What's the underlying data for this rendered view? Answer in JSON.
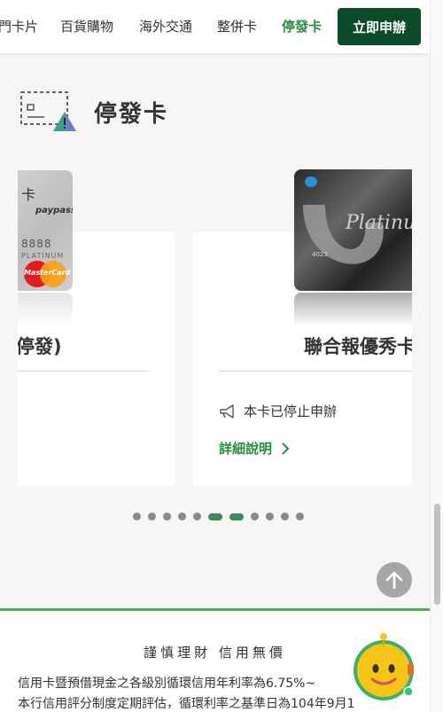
{
  "nav": {
    "items": [
      {
        "label": "門卡片"
      },
      {
        "label": "百貨購物"
      },
      {
        "label": "海外交通"
      },
      {
        "label": "整併卡"
      },
      {
        "label": "停發卡"
      }
    ],
    "active_index": 4,
    "apply_label": "立即申辦"
  },
  "section": {
    "title": "停發卡",
    "icon": "discontinued-card-warning-icon"
  },
  "carousel": {
    "card_left": {
      "title": "停發)",
      "card_text": "卡",
      "paypass": "paypass",
      "number": "8888",
      "tier": "PLATINUM",
      "brand": "MasterCard"
    },
    "card_right": {
      "title": "聯合報優秀卡",
      "card_tier": "Platinum",
      "card_number": "4023",
      "status": "本卡已停止申辦",
      "detail_label": "詳細說明"
    },
    "dots_total": 11,
    "active_dots": [
      5,
      6
    ]
  },
  "footer": {
    "slogan": "謹慎理財 信用無價",
    "notice_line1": "信用卡暨預借現金之各級別循環信用年利率為6.75%~",
    "notice_line2": "本行信用評分制度定期評估，循環利率之基準日為104年9月1"
  },
  "colors": {
    "accent_green": "#2e8b3d",
    "dark_green": "#0d4a2a",
    "footer_border": "#4caf50"
  }
}
